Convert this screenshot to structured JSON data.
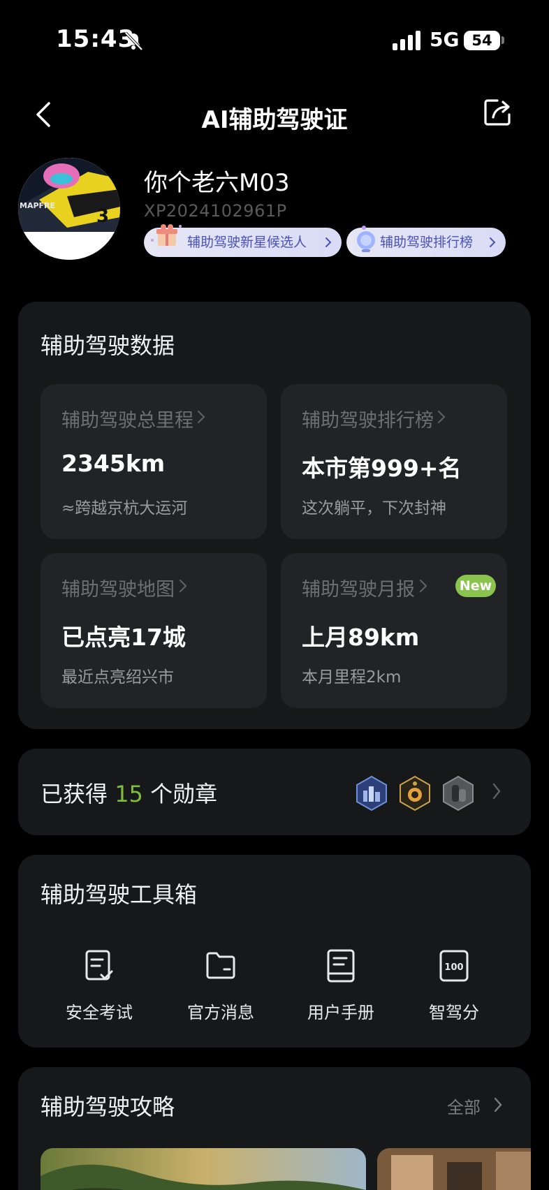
{
  "status_bar": {
    "time": "15:43",
    "network": "5G",
    "battery": "54",
    "icons": [
      "bell-slash-icon",
      "signal-icon"
    ]
  },
  "nav": {
    "title": "AI辅助驾驶证",
    "icons": [
      "back-chevron-icon",
      "share-icon"
    ]
  },
  "profile": {
    "name": "你个老六M03",
    "id": "XP2024102961P",
    "tags": [
      {
        "label": "辅助驾驶新星候选人",
        "icon": "gift-icon"
      },
      {
        "label": "辅助驾驶排行榜",
        "icon": "trophy-icon"
      }
    ]
  },
  "data_section": {
    "title": "辅助驾驶数据",
    "tiles": [
      {
        "label": "辅助驾驶总里程",
        "value": "2345km",
        "sub": "≈跨越京杭大运河"
      },
      {
        "label": "辅助驾驶排行榜",
        "value": "本市第999+名",
        "sub": "这次躺平，下次封神"
      },
      {
        "label": "辅助驾驶地图",
        "value": "已点亮17城",
        "sub": "最近点亮绍兴市"
      },
      {
        "label": "辅助驾驶月报",
        "value": "上月89km",
        "sub": "本月里程2km",
        "badge": "New"
      }
    ]
  },
  "badges": {
    "prefix": "已获得",
    "count": "15",
    "suffix": "个勋章",
    "accent": "#7fbd3e",
    "icons": [
      "city-medal-icon",
      "gold-medal-icon",
      "silver-medal-icon"
    ]
  },
  "toolbox": {
    "title": "辅助驾驶工具箱",
    "items": [
      {
        "label": "安全考试",
        "icon": "exam-icon"
      },
      {
        "label": "官方消息",
        "icon": "folder-icon"
      },
      {
        "label": "用户手册",
        "icon": "book-icon"
      },
      {
        "label": "智驾分",
        "icon": "score-100-icon",
        "icon_text": "100"
      }
    ]
  },
  "guide": {
    "title": "辅助驾驶攻略",
    "all_label": "全部"
  },
  "colors": {
    "background": "#000000",
    "card": "#17181a",
    "tile": "#222326",
    "accent_green": "#7fbd3e",
    "pill_text": "#4a52b8"
  }
}
